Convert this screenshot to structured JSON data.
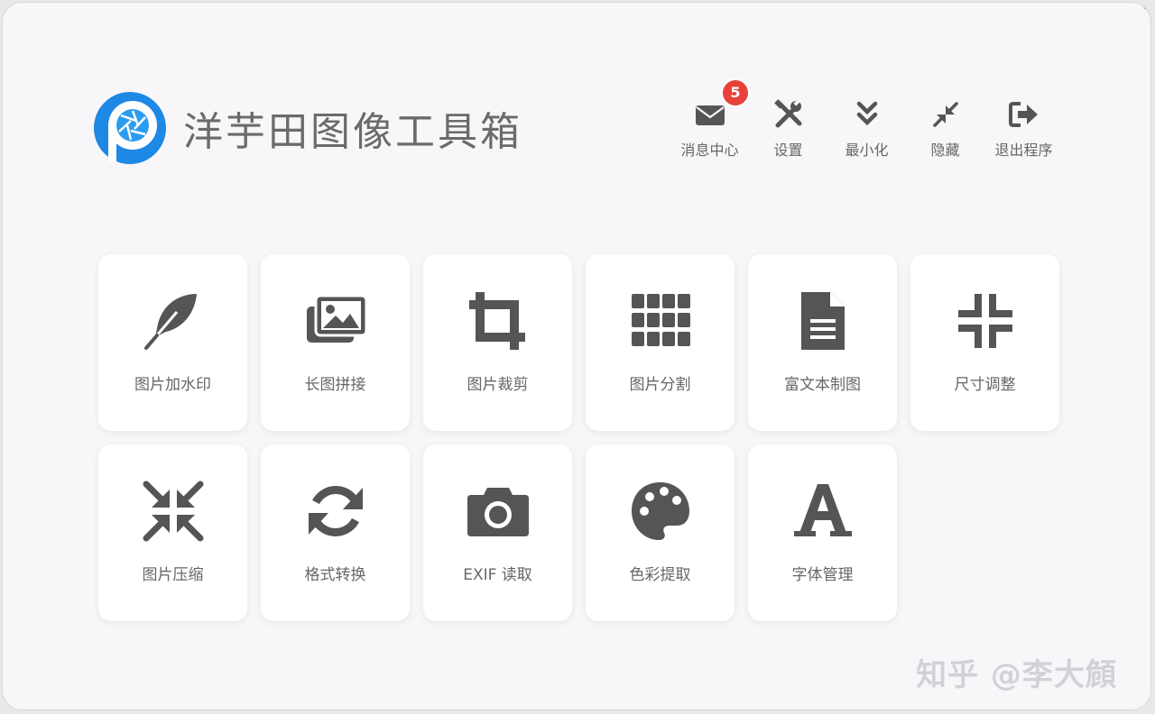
{
  "app": {
    "title": "洋芋田图像工具箱",
    "brand_color": "#1e88e5"
  },
  "toolbar": {
    "message": {
      "label": "消息中心",
      "badge": "5",
      "icon": "envelope-icon"
    },
    "settings": {
      "label": "设置",
      "icon": "tools-icon"
    },
    "minimize": {
      "label": "最小化",
      "icon": "chevron-double-down-icon"
    },
    "hide": {
      "label": "隐藏",
      "icon": "compress-arrows-icon"
    },
    "exit": {
      "label": "退出程序",
      "icon": "sign-out-icon"
    }
  },
  "tools": [
    {
      "label": "图片加水印",
      "icon": "feather-icon"
    },
    {
      "label": "长图拼接",
      "icon": "images-icon"
    },
    {
      "label": "图片裁剪",
      "icon": "crop-icon"
    },
    {
      "label": "图片分割",
      "icon": "grid-icon"
    },
    {
      "label": "富文本制图",
      "icon": "document-icon"
    },
    {
      "label": "尺寸调整",
      "icon": "compress-icon"
    },
    {
      "label": "图片压缩",
      "icon": "compress-arrows-icon"
    },
    {
      "label": "格式转换",
      "icon": "refresh-icon"
    },
    {
      "label": "EXIF 读取",
      "icon": "camera-icon"
    },
    {
      "label": "色彩提取",
      "icon": "palette-icon"
    },
    {
      "label": "字体管理",
      "icon": "font-icon"
    }
  ],
  "badge_color": "#e8413a",
  "icon_color": "#555555",
  "watermark": "知乎 @李大頠"
}
